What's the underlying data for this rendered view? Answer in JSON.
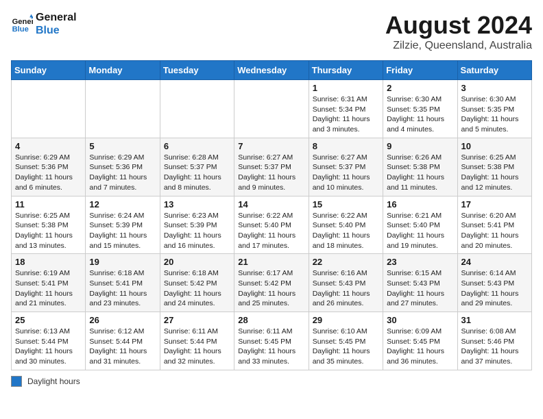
{
  "header": {
    "logo_line1": "General",
    "logo_line2": "Blue",
    "month_title": "August 2024",
    "location": "Zilzie, Queensland, Australia"
  },
  "days_of_week": [
    "Sunday",
    "Monday",
    "Tuesday",
    "Wednesday",
    "Thursday",
    "Friday",
    "Saturday"
  ],
  "weeks": [
    [
      {
        "day": "",
        "info": ""
      },
      {
        "day": "",
        "info": ""
      },
      {
        "day": "",
        "info": ""
      },
      {
        "day": "",
        "info": ""
      },
      {
        "day": "1",
        "info": "Sunrise: 6:31 AM\nSunset: 5:34 PM\nDaylight: 11 hours and 3 minutes."
      },
      {
        "day": "2",
        "info": "Sunrise: 6:30 AM\nSunset: 5:35 PM\nDaylight: 11 hours and 4 minutes."
      },
      {
        "day": "3",
        "info": "Sunrise: 6:30 AM\nSunset: 5:35 PM\nDaylight: 11 hours and 5 minutes."
      }
    ],
    [
      {
        "day": "4",
        "info": "Sunrise: 6:29 AM\nSunset: 5:36 PM\nDaylight: 11 hours and 6 minutes."
      },
      {
        "day": "5",
        "info": "Sunrise: 6:29 AM\nSunset: 5:36 PM\nDaylight: 11 hours and 7 minutes."
      },
      {
        "day": "6",
        "info": "Sunrise: 6:28 AM\nSunset: 5:37 PM\nDaylight: 11 hours and 8 minutes."
      },
      {
        "day": "7",
        "info": "Sunrise: 6:27 AM\nSunset: 5:37 PM\nDaylight: 11 hours and 9 minutes."
      },
      {
        "day": "8",
        "info": "Sunrise: 6:27 AM\nSunset: 5:37 PM\nDaylight: 11 hours and 10 minutes."
      },
      {
        "day": "9",
        "info": "Sunrise: 6:26 AM\nSunset: 5:38 PM\nDaylight: 11 hours and 11 minutes."
      },
      {
        "day": "10",
        "info": "Sunrise: 6:25 AM\nSunset: 5:38 PM\nDaylight: 11 hours and 12 minutes."
      }
    ],
    [
      {
        "day": "11",
        "info": "Sunrise: 6:25 AM\nSunset: 5:38 PM\nDaylight: 11 hours and 13 minutes."
      },
      {
        "day": "12",
        "info": "Sunrise: 6:24 AM\nSunset: 5:39 PM\nDaylight: 11 hours and 15 minutes."
      },
      {
        "day": "13",
        "info": "Sunrise: 6:23 AM\nSunset: 5:39 PM\nDaylight: 11 hours and 16 minutes."
      },
      {
        "day": "14",
        "info": "Sunrise: 6:22 AM\nSunset: 5:40 PM\nDaylight: 11 hours and 17 minutes."
      },
      {
        "day": "15",
        "info": "Sunrise: 6:22 AM\nSunset: 5:40 PM\nDaylight: 11 hours and 18 minutes."
      },
      {
        "day": "16",
        "info": "Sunrise: 6:21 AM\nSunset: 5:40 PM\nDaylight: 11 hours and 19 minutes."
      },
      {
        "day": "17",
        "info": "Sunrise: 6:20 AM\nSunset: 5:41 PM\nDaylight: 11 hours and 20 minutes."
      }
    ],
    [
      {
        "day": "18",
        "info": "Sunrise: 6:19 AM\nSunset: 5:41 PM\nDaylight: 11 hours and 21 minutes."
      },
      {
        "day": "19",
        "info": "Sunrise: 6:18 AM\nSunset: 5:41 PM\nDaylight: 11 hours and 23 minutes."
      },
      {
        "day": "20",
        "info": "Sunrise: 6:18 AM\nSunset: 5:42 PM\nDaylight: 11 hours and 24 minutes."
      },
      {
        "day": "21",
        "info": "Sunrise: 6:17 AM\nSunset: 5:42 PM\nDaylight: 11 hours and 25 minutes."
      },
      {
        "day": "22",
        "info": "Sunrise: 6:16 AM\nSunset: 5:43 PM\nDaylight: 11 hours and 26 minutes."
      },
      {
        "day": "23",
        "info": "Sunrise: 6:15 AM\nSunset: 5:43 PM\nDaylight: 11 hours and 27 minutes."
      },
      {
        "day": "24",
        "info": "Sunrise: 6:14 AM\nSunset: 5:43 PM\nDaylight: 11 hours and 29 minutes."
      }
    ],
    [
      {
        "day": "25",
        "info": "Sunrise: 6:13 AM\nSunset: 5:44 PM\nDaylight: 11 hours and 30 minutes."
      },
      {
        "day": "26",
        "info": "Sunrise: 6:12 AM\nSunset: 5:44 PM\nDaylight: 11 hours and 31 minutes."
      },
      {
        "day": "27",
        "info": "Sunrise: 6:11 AM\nSunset: 5:44 PM\nDaylight: 11 hours and 32 minutes."
      },
      {
        "day": "28",
        "info": "Sunrise: 6:11 AM\nSunset: 5:45 PM\nDaylight: 11 hours and 33 minutes."
      },
      {
        "day": "29",
        "info": "Sunrise: 6:10 AM\nSunset: 5:45 PM\nDaylight: 11 hours and 35 minutes."
      },
      {
        "day": "30",
        "info": "Sunrise: 6:09 AM\nSunset: 5:45 PM\nDaylight: 11 hours and 36 minutes."
      },
      {
        "day": "31",
        "info": "Sunrise: 6:08 AM\nSunset: 5:46 PM\nDaylight: 11 hours and 37 minutes."
      }
    ]
  ],
  "footer": {
    "legend_label": "Daylight hours"
  }
}
